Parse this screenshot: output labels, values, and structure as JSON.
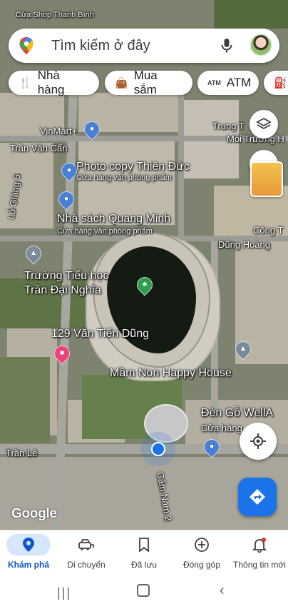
{
  "status_bar": {
    "time": "",
    "signal": ""
  },
  "search": {
    "placeholder": "Tìm kiếm ở đây"
  },
  "chips": [
    {
      "label": "Nhà hàng",
      "icon": "fork-knife-icon"
    },
    {
      "label": "Mua sắm",
      "icon": "shopping-bag-icon"
    },
    {
      "label": "ATM",
      "icon": "atm-icon"
    }
  ],
  "map_labels": {
    "top_left": "Cửa Shop Thanh Bình",
    "vinmart": "VinMart+",
    "tran_van_can": "Trần Văn Cẩn",
    "lo_giang": "Lỗ Giáng 5",
    "photo_copy": "Photo copy Thiên Đức",
    "photo_copy_sub": "Cửa hàng văn phòng phẩm",
    "nha_sach": "Nhà sách Quang Minh",
    "nha_sach_sub": "Cửa hàng văn phòng phẩm",
    "truong_tieu_hoc_1": "Trường Tiểu học",
    "truong_tieu_hoc_2": "Trần Đại Nghĩa",
    "van_tien_dung": "129 Văn Tiến Dũng",
    "mam_non": "Mầm Non Happy House",
    "den_go": "Đèn Gỗ WellA",
    "den_go_sub": "Cửa hàng",
    "tran_le": "Trần Lê",
    "cam_nam": "Cẩm Nam 2",
    "trung_t": "Trung T",
    "moi_truong": "Môi Trường H",
    "cong_t": "Công T",
    "dung_hoang": "Dũng Hoàng",
    "google": "Google"
  },
  "bottom_nav": [
    {
      "label": "Khám phá",
      "icon": "explore-pin-icon",
      "active": true
    },
    {
      "label": "Di chuyển",
      "icon": "commute-car-icon",
      "active": false
    },
    {
      "label": "Đã lưu",
      "icon": "bookmark-icon",
      "active": false
    },
    {
      "label": "Đóng góp",
      "icon": "add-circle-icon",
      "active": false
    },
    {
      "label": "Thông tin mới",
      "icon": "bell-icon",
      "active": false
    }
  ],
  "colors": {
    "accent": "#1a73e8",
    "active_tab_bg": "#d6e6fb",
    "hotel_pin": "#e8437a",
    "shop_pin": "#4a7fd6",
    "school_pin": "#7a8a98"
  }
}
